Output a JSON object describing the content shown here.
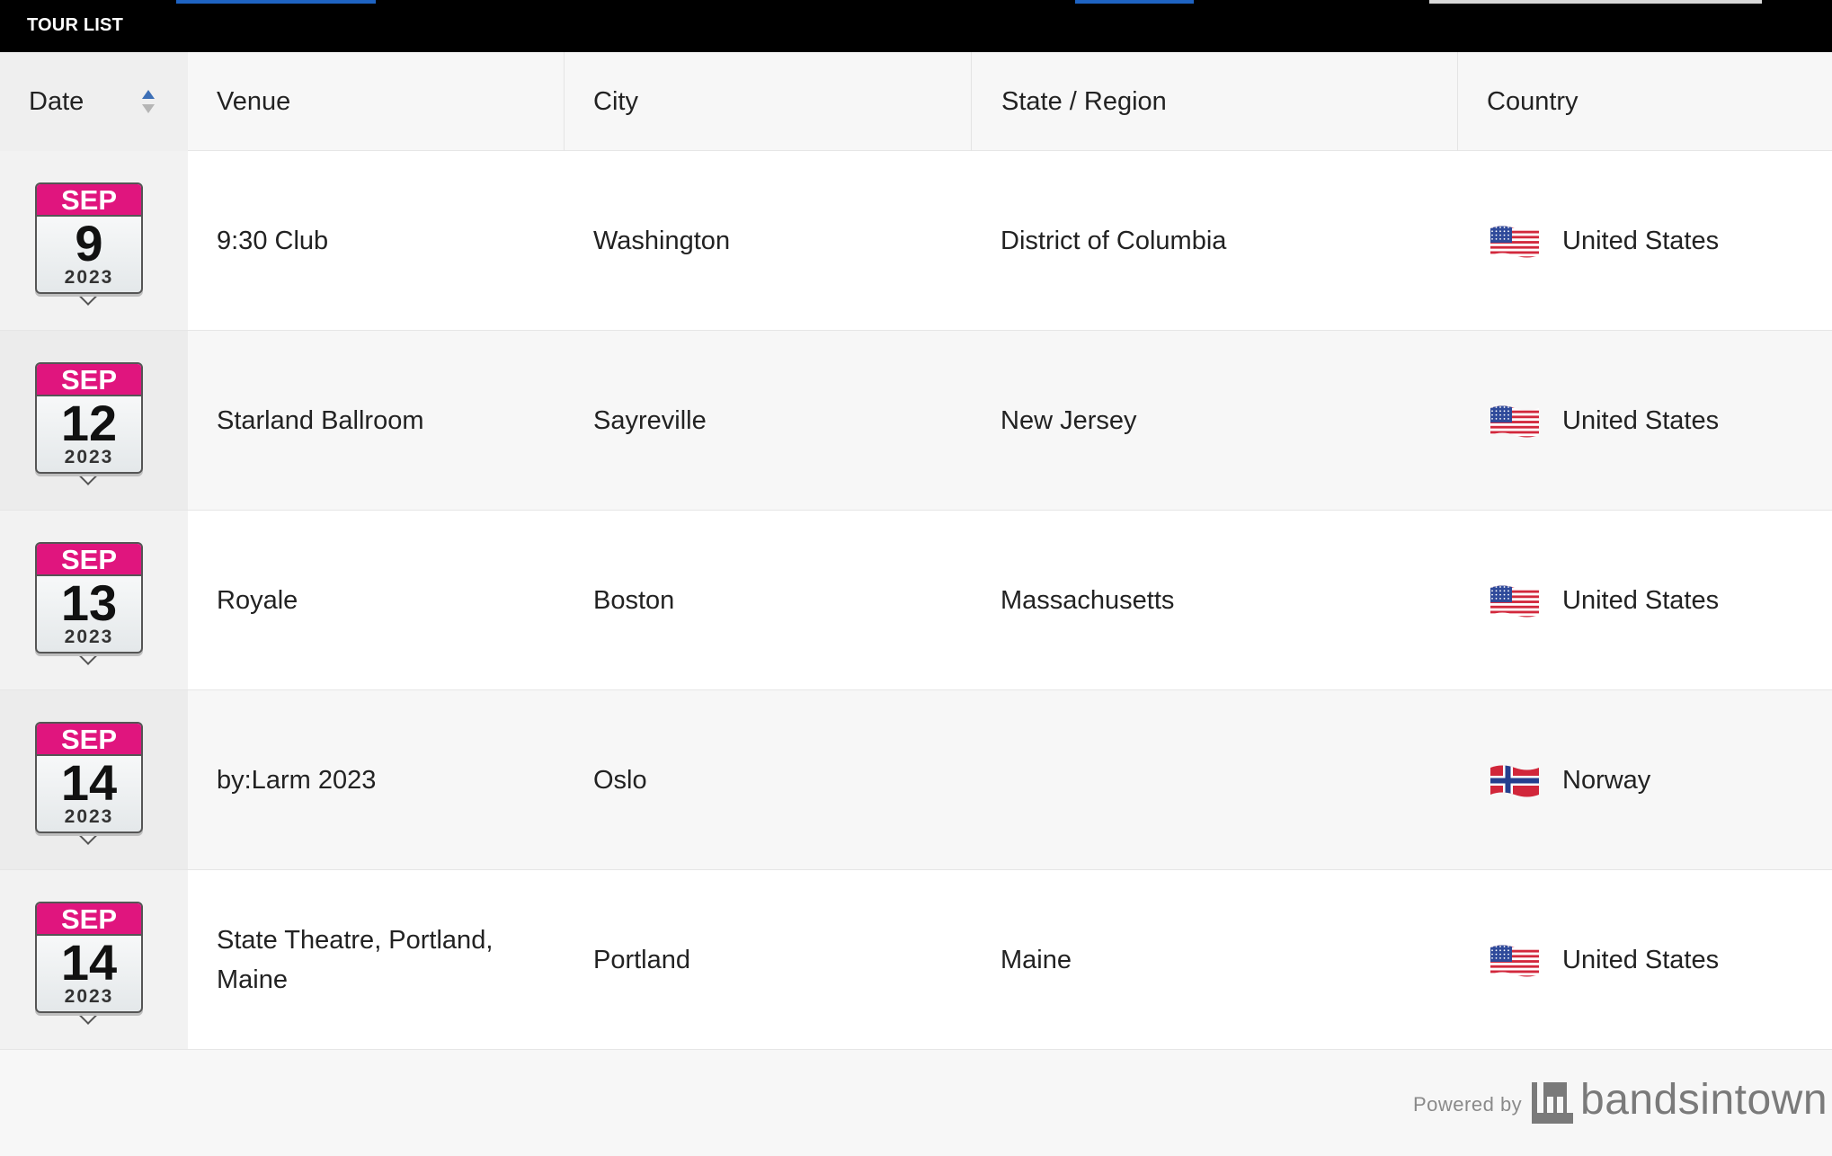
{
  "header": {
    "title": "TOUR LIST"
  },
  "columns": {
    "date": "Date",
    "venue": "Venue",
    "city": "City",
    "state": "State / Region",
    "country": "Country"
  },
  "rows": [
    {
      "month": "SEP",
      "day": "9",
      "year": "2023",
      "venue": "9:30 Club",
      "city": "Washington",
      "state": "District of Columbia",
      "country": "United States",
      "flag": "us-flag-icon"
    },
    {
      "month": "SEP",
      "day": "12",
      "year": "2023",
      "venue": "Starland Ballroom",
      "city": "Sayreville",
      "state": "New Jersey",
      "country": "United States",
      "flag": "us-flag-icon"
    },
    {
      "month": "SEP",
      "day": "13",
      "year": "2023",
      "venue": "Royale",
      "city": "Boston",
      "state": "Massachusetts",
      "country": "United States",
      "flag": "us-flag-icon"
    },
    {
      "month": "SEP",
      "day": "14",
      "year": "2023",
      "venue": "by:Larm 2023",
      "city": "Oslo",
      "state": "",
      "country": "Norway",
      "flag": "norway-flag-icon"
    },
    {
      "month": "SEP",
      "day": "14",
      "year": "2023",
      "venue": "State Theatre, Portland, Maine",
      "city": "Portland",
      "state": "Maine",
      "country": "United States",
      "flag": "us-flag-icon"
    }
  ],
  "footer": {
    "powered_by": "Powered by",
    "brand": "bandsintown"
  },
  "colors": {
    "accent": "#e0157e",
    "topbar": "#000000",
    "sort_active": "#3d6fb6"
  }
}
